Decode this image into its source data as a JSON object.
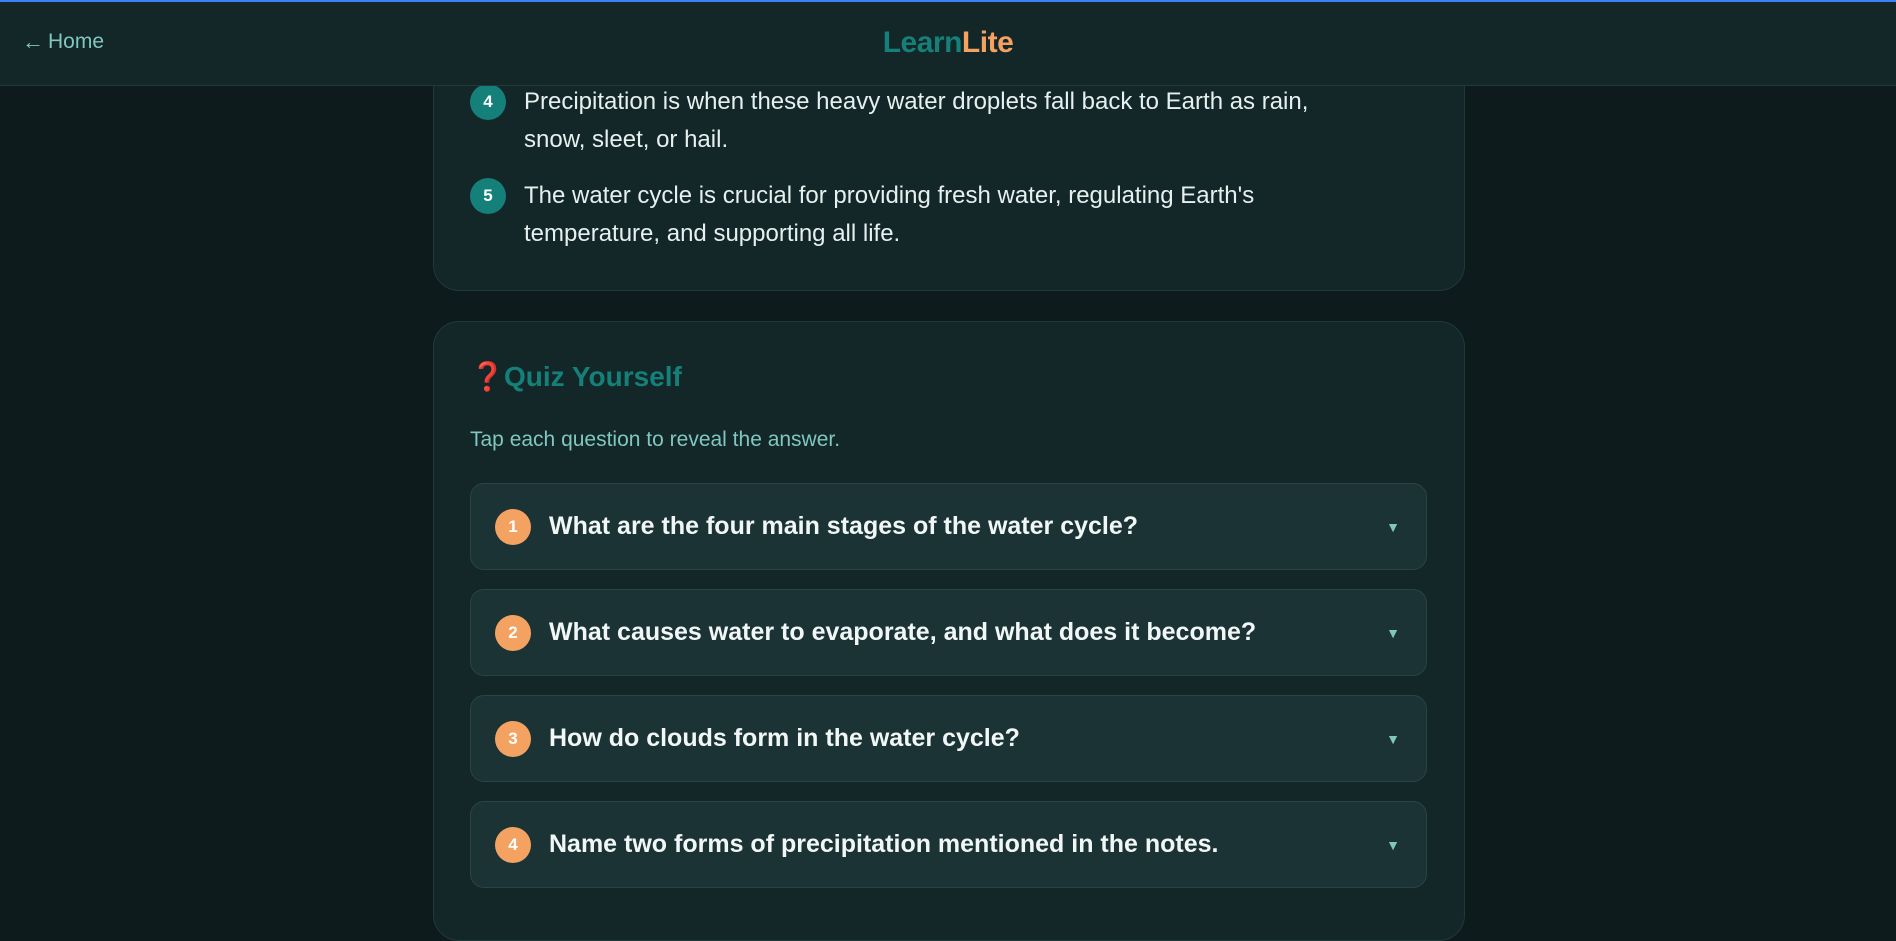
{
  "header": {
    "back_arrow": "←",
    "back_label": "Home",
    "logo_part1": "Learn",
    "logo_part2": "Lite"
  },
  "notes": [
    {
      "num": "4",
      "text": "Precipitation is when these heavy water droplets fall back to Earth as rain, snow, sleet, or hail."
    },
    {
      "num": "5",
      "text": "The water cycle is crucial for providing fresh water, regulating Earth's temperature, and supporting all life."
    }
  ],
  "quiz": {
    "icon": "❓",
    "title": "Quiz Yourself",
    "subtitle": "Tap each question to reveal the answer.",
    "questions": [
      {
        "num": "1",
        "text": "What are the four main stages of the water cycle?"
      },
      {
        "num": "2",
        "text": "What causes water to evaporate, and what does it become?"
      },
      {
        "num": "3",
        "text": "How do clouds form in the water cycle?"
      },
      {
        "num": "4",
        "text": "Name two forms of precipitation mentioned in the notes."
      }
    ],
    "chevron": "▼"
  },
  "colors": {
    "accent_teal": "#15807a",
    "accent_orange": "#f4a261",
    "background": "#0d1b1c",
    "card": "#132628"
  }
}
